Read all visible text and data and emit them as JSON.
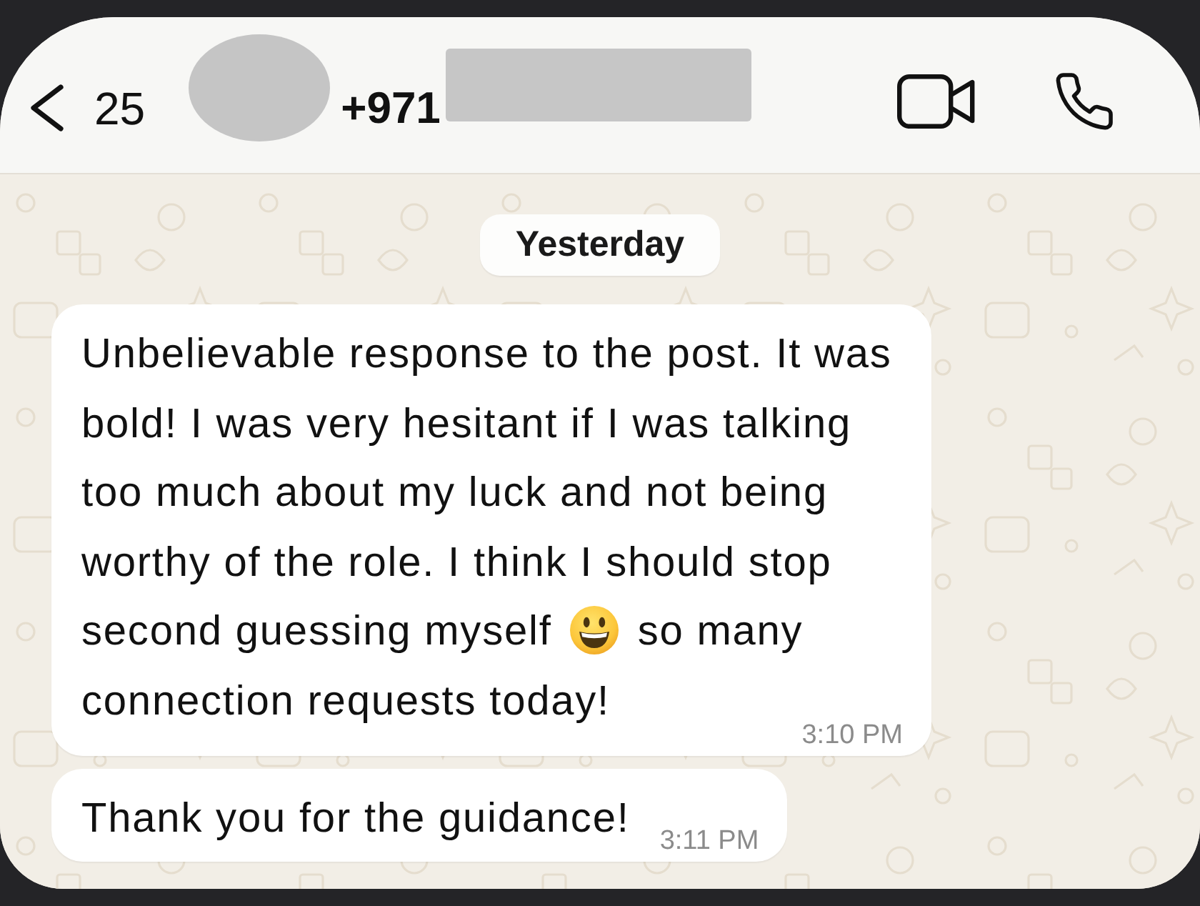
{
  "header": {
    "back_count": "25",
    "contact_name": "+971"
  },
  "date_label": "Yesterday",
  "messages": [
    {
      "segments": [
        {
          "kind": "text",
          "text": "Unbelievable response to the post. It was bold! I was very hesitant if I was talking too much about my luck and not being worthy of the role. I think I should stop second guessing myself"
        },
        {
          "kind": "emoji"
        },
        {
          "kind": "text",
          "text": "so many connection requests today!"
        }
      ],
      "time": "3:10 PM"
    },
    {
      "segments": [
        {
          "kind": "text",
          "text": "Thank you for the guidance!"
        }
      ],
      "time": "3:11 PM"
    }
  ]
}
